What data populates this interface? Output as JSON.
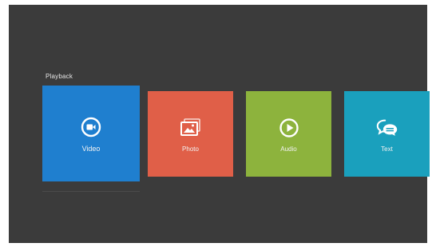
{
  "section": {
    "title": "Playback"
  },
  "tiles": [
    {
      "label": "Video",
      "icon": "video-camera-icon",
      "color": "#1f7fcf"
    },
    {
      "label": "Photo",
      "icon": "photo-icon",
      "color": "#e05f48"
    },
    {
      "label": "Audio",
      "icon": "play-circle-icon",
      "color": "#8db33d"
    },
    {
      "label": "Text",
      "icon": "chat-bubbles-icon",
      "color": "#1aa0bd"
    }
  ],
  "colors": {
    "background": "#3b3b3b",
    "focused_tile": "#1f7fcf"
  }
}
